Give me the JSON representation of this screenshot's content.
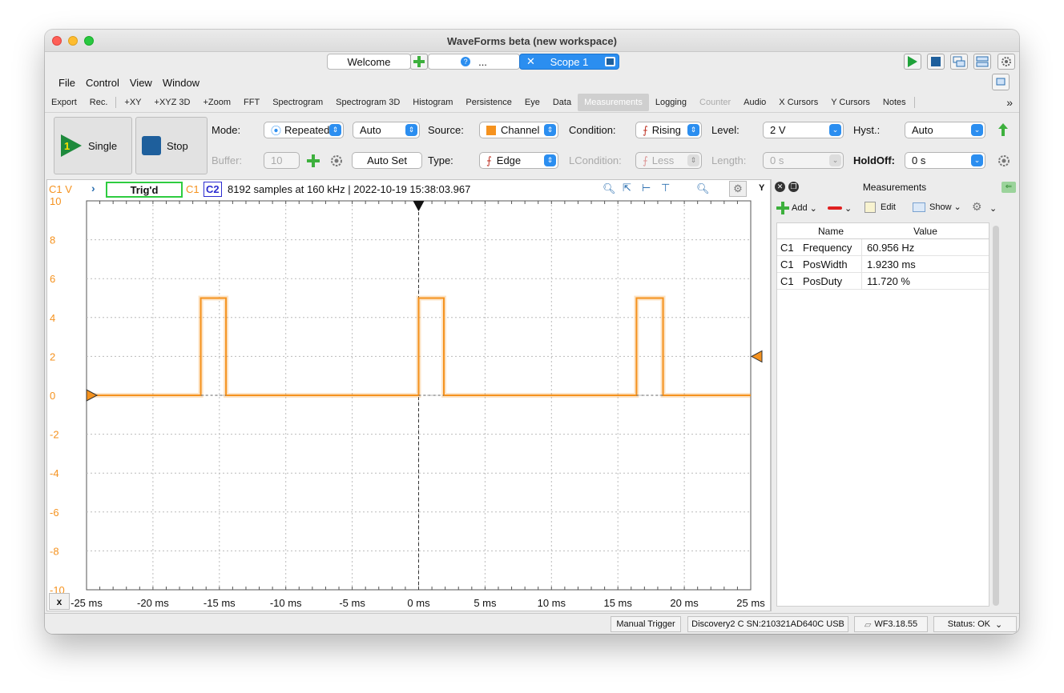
{
  "window": {
    "title": "WaveForms beta (new workspace)"
  },
  "tabs": {
    "welcome": "Welcome",
    "help": "...",
    "scope": "Scope 1"
  },
  "menu": [
    "File",
    "Control",
    "Window"
  ],
  "tools": [
    "Export",
    "Rec.",
    "+XY",
    "+XYZ 3D",
    "+Zoom",
    "FFT",
    "Spectrogram",
    "Spectrogram 3D",
    "Histogram",
    "Persistence",
    "Eye",
    "Data",
    "Measurements",
    "Logging",
    "Counter",
    "Audio",
    "X Cursors",
    "Y Cursors",
    "Notes"
  ],
  "controls": {
    "single": "Single",
    "stop": "Stop",
    "mode_label": "Mode:",
    "mode_value": "Repeated",
    "auto_value": "Auto",
    "buffer_label": "Buffer:",
    "buffer_value": "10",
    "auto_set": "Auto Set",
    "source_label": "Source:",
    "source_value": "Channel",
    "type_label": "Type:",
    "type_value": "Edge",
    "condition_label": "Condition:",
    "condition_value": "Rising",
    "lcondition_label": "LCondition:",
    "lcondition_value": "Less",
    "level_label": "Level:",
    "level_value": "2 V",
    "length_label": "Length:",
    "length_value": "0 s",
    "hyst_label": "Hyst.:",
    "hyst_value": "Auto",
    "holdoff_label": "HoldOff:",
    "holdoff_value": "0 s",
    "accent": "#2b8ef0"
  },
  "plot": {
    "channel_label": "C1 V",
    "status": "Trig'd",
    "c1": "C1",
    "c2": "C2",
    "info": "8192 samples at 160 kHz | 2022-10-19 15:38:03.967",
    "y_axis_btn": "Y",
    "x_axis_btn": "x",
    "trace_color": "#f5921e"
  },
  "chart_data": {
    "type": "line",
    "title": "",
    "xlabel": "",
    "ylabel": "C1 V",
    "xlim": [
      -25,
      25
    ],
    "ylim": [
      -10,
      10
    ],
    "x_ticks": [
      "-25 ms",
      "-20 ms",
      "-15 ms",
      "-10 ms",
      "-5 ms",
      "0 ms",
      "5 ms",
      "10 ms",
      "15 ms",
      "20 ms",
      "25 ms"
    ],
    "y_ticks": [
      "10",
      "8",
      "6",
      "4",
      "2",
      "0",
      "-2",
      "-4",
      "-6",
      "-8",
      "-10"
    ],
    "series": [
      {
        "name": "C1",
        "color": "#f5921e",
        "x": [
          -25,
          -16.4,
          -16.4,
          -14.5,
          -14.5,
          0,
          0,
          1.9,
          1.9,
          16.4,
          16.4,
          18.4,
          18.4,
          25
        ],
        "y": [
          0,
          0,
          5,
          5,
          0,
          0,
          5,
          5,
          0,
          0,
          5,
          5,
          0,
          0
        ]
      }
    ],
    "trigger_level": 2,
    "grid": true
  },
  "measurements": {
    "title": "Measurements",
    "add": "Add",
    "edit": "Edit",
    "show": "Show",
    "columns": [
      "Name",
      "Value"
    ],
    "rows": [
      {
        "ch": "C1",
        "name": "Frequency",
        "value": "60.956 Hz"
      },
      {
        "ch": "C1",
        "name": "PosWidth",
        "value": "1.9230 ms"
      },
      {
        "ch": "C1",
        "name": "PosDuty",
        "value": "11.720 %"
      }
    ]
  },
  "status": {
    "manual_trigger": "Manual Trigger",
    "device": "Discovery2 C SN:210321AD640C USB",
    "version": "WF3.18.55",
    "status": "Status: OK"
  }
}
